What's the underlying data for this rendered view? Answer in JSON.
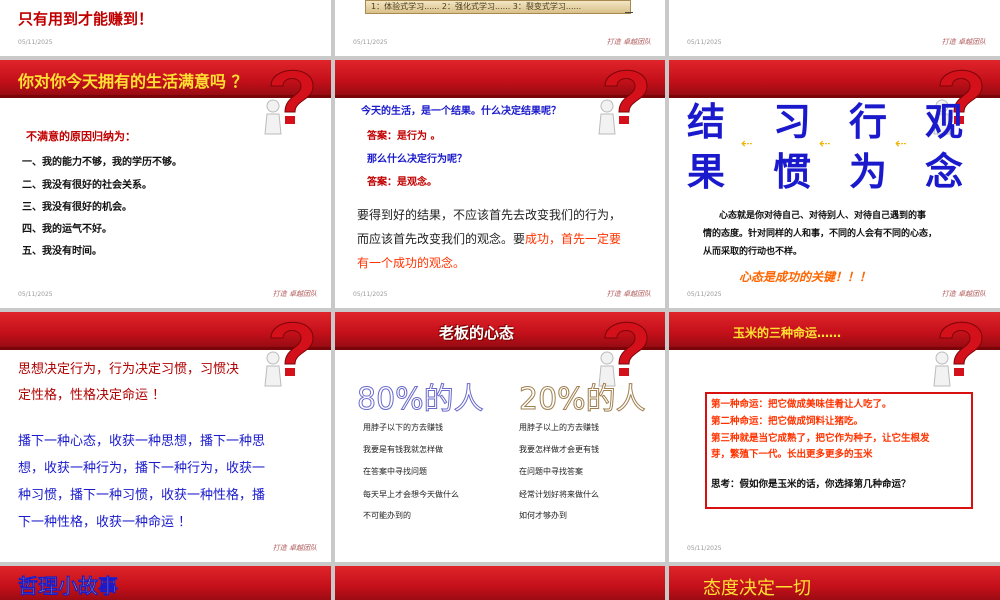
{
  "footer": {
    "date": "05/11/2025",
    "brand": "打造 卓越团队"
  },
  "top_row": {
    "s1_text": "只有用到才能赚到！",
    "s2_bar": "1：体验式学习...... 2：强化式学习...... 3：裂变式学习......"
  },
  "slide_a": {
    "title": "你对你今天拥有的生活满意吗 ？",
    "heading": "不满意的原因归纳为：",
    "items": [
      "一、我的能力不够，我的学历不够。",
      "二、我没有很好的社会关系。",
      "三、我没有很好的机会。",
      "四、我的运气不好。",
      "五、我没有时间。"
    ]
  },
  "slide_b": {
    "q1": "今天的生活，是一个结果。什么决定结果呢？",
    "a1": "答案：是行为 。",
    "q2": "那么什么决定行为呢？",
    "a2": "答案：是观念。",
    "p1": "要得到好的结果，不应该首先去改变我们的行为，",
    "p2": "而应该首先改变我们的观念。要",
    "p2_red": "成功，首先一定要",
    "p3_red": "有一个成功的观念。"
  },
  "slide_c": {
    "chars": [
      [
        "结",
        "果"
      ],
      [
        "习",
        "惯"
      ],
      [
        "行",
        "为"
      ],
      [
        "观",
        "念"
      ]
    ],
    "para": [
      "心态就是你对待自己、对待别人、对待自己遇到的事",
      "情的态度。针对同样的人和事，不同的人会有不同的心态，",
      "从而采取的行动也不样。"
    ],
    "slogan": "心态是成功的关键！！！"
  },
  "slide_d": {
    "red_lines": [
      "思想决定行为，行为决定习惯，习惯决",
      "定性格，性格决定命运 ！"
    ],
    "blue_lines": [
      "播下一种心态，收获一种思想，播下一种思",
      "想，收获一种行为，播下一种行为，收获一",
      "种习惯，播下一种习惯，收获一种性格，播",
      "下一种性格，收获一种命运 ！"
    ]
  },
  "slide_e": {
    "title": "老板的心态",
    "left_head": "80%的人",
    "right_head": "20%的人",
    "left_items": [
      "用脖子以下的方去赚钱",
      "我要是有钱我就怎样做",
      "在答案中寻找问题",
      "每天早上才会想今天做什么",
      "不可能办到的"
    ],
    "right_items": [
      "用脖子以上的方去赚钱",
      "我要怎样做才会更有钱",
      "在问题中寻找答案",
      "经常计划好将来做什么",
      "如何才够办到"
    ]
  },
  "slide_f": {
    "title": "玉米的三种命运……",
    "lines": [
      "第一种命运：把它做成美味佳肴让人吃了。",
      "第二种命运：把它做成饲料让猪吃。",
      "第三种就是当它成熟了，把它作为种子，让它生根发",
      "芽，繁殖下一代。长出更多更多的玉米"
    ],
    "question": "思考：假如你是玉米的话，你选择第几种命运？"
  },
  "bottom_row": {
    "g_title": "哲理小故事",
    "i_title": "态度决定一切"
  }
}
